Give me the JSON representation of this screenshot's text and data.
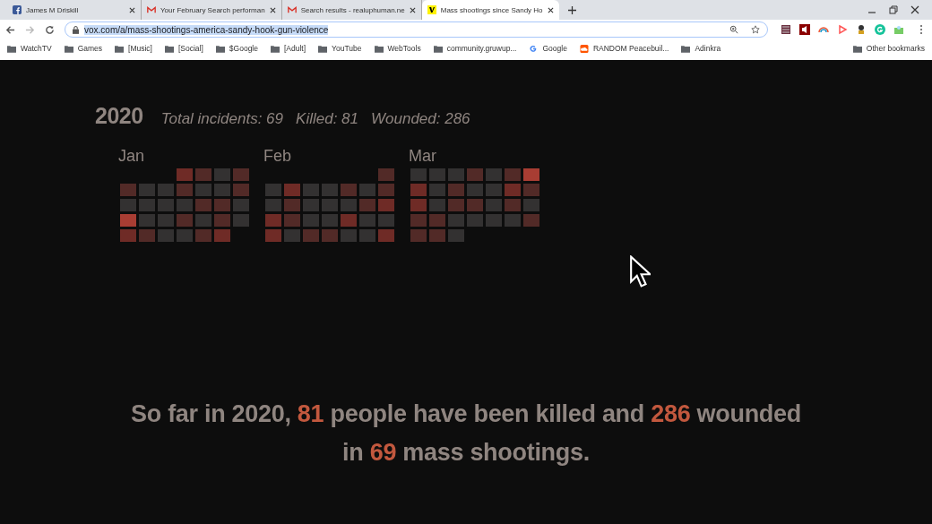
{
  "tabs": [
    {
      "title": "James M Driskill",
      "kind": "facebook",
      "selected": false
    },
    {
      "title": "Your February Search performan",
      "kind": "mail",
      "selected": false
    },
    {
      "title": "Search results - realuphuman.ne",
      "kind": "mail",
      "selected": false
    },
    {
      "title": "Mass shootings since Sandy Ho",
      "kind": "vox",
      "selected": true
    }
  ],
  "address": {
    "url": "vox.com/a/mass-shootings-america-sandy-hook-gun-violence"
  },
  "bookmarks": [
    {
      "label": "WatchTV",
      "kind": "folder"
    },
    {
      "label": "Games",
      "kind": "folder"
    },
    {
      "label": "[Music]",
      "kind": "folder"
    },
    {
      "label": "[Social]",
      "kind": "folder"
    },
    {
      "label": "$Google",
      "kind": "folder"
    },
    {
      "label": "[Adult]",
      "kind": "folder"
    },
    {
      "label": "YouTube",
      "kind": "folder"
    },
    {
      "label": "WebTools",
      "kind": "folder"
    },
    {
      "label": "community.gruwup...",
      "kind": "folder"
    },
    {
      "label": "Google",
      "kind": "google"
    },
    {
      "label": "RANDOM Peacebuil...",
      "kind": "cloud"
    },
    {
      "label": "Adinkra",
      "kind": "folder"
    }
  ],
  "other_bookmarks": "Other bookmarks",
  "summary": {
    "year": "2020",
    "stats": [
      "Total incidents: 69",
      "Killed: 81",
      "Wounded: 286"
    ]
  },
  "months": [
    {
      "label": "Jan",
      "days": [
        {
          "color": "#6f2b26"
        },
        {
          "color": "#522a27"
        },
        {
          "color": "#333131"
        },
        {
          "color": "#522a27"
        },
        {
          "color": "#522a27"
        },
        {
          "color": "#333131"
        },
        {
          "color": "#333131"
        },
        {
          "color": "#522a27"
        },
        {
          "color": "#333131"
        },
        {
          "color": "#333131"
        },
        {
          "color": "#522a27"
        },
        {
          "color": "#333131"
        },
        {
          "color": "#333131"
        },
        {
          "color": "#333131"
        },
        {
          "color": "#333131"
        },
        {
          "color": "#522a27"
        },
        {
          "color": "#522a27"
        },
        {
          "color": "#333131"
        },
        {
          "color": "#a83d33"
        },
        {
          "color": "#333131"
        },
        {
          "color": "#333131"
        },
        {
          "color": "#522a27"
        },
        {
          "color": "#333131"
        },
        {
          "color": "#522a27"
        },
        {
          "color": "#333131"
        },
        {
          "color": "#6f2b26"
        },
        {
          "color": "#522a27"
        },
        {
          "color": "#333131"
        },
        {
          "color": "#333131"
        },
        {
          "color": "#522a27"
        },
        {
          "color": "#6f2b26"
        }
      ]
    },
    {
      "label": "Feb",
      "days": [
        {
          "color": "#522a27"
        },
        {
          "color": "#333131"
        },
        {
          "color": "#6f2b26"
        },
        {
          "color": "#333131"
        },
        {
          "color": "#333131"
        },
        {
          "color": "#522a27"
        },
        {
          "color": "#333131"
        },
        {
          "color": "#522a27"
        },
        {
          "color": "#333131"
        },
        {
          "color": "#522a27"
        },
        {
          "color": "#333131"
        },
        {
          "color": "#333131"
        },
        {
          "color": "#333131"
        },
        {
          "color": "#522a27"
        },
        {
          "color": "#6f2b26"
        },
        {
          "color": "#6f2b26"
        },
        {
          "color": "#522a27"
        },
        {
          "color": "#333131"
        },
        {
          "color": "#333131"
        },
        {
          "color": "#6f2b26"
        },
        {
          "color": "#333131"
        },
        {
          "color": "#333131"
        },
        {
          "color": "#6f2b26"
        },
        {
          "color": "#333131"
        },
        {
          "color": "#522a27"
        },
        {
          "color": "#522a27"
        },
        {
          "color": "#333131"
        },
        {
          "color": "#333131"
        },
        {
          "color": "#6f2b26"
        }
      ]
    },
    {
      "label": "Mar",
      "days": [
        {
          "color": "#333131"
        },
        {
          "color": "#333131"
        },
        {
          "color": "#333131"
        },
        {
          "color": "#522a27"
        },
        {
          "color": "#333131"
        },
        {
          "color": "#522a27"
        },
        {
          "color": "#a83d33"
        },
        {
          "color": "#6f2b26"
        },
        {
          "color": "#333131"
        },
        {
          "color": "#522a27"
        },
        {
          "color": "#333131"
        },
        {
          "color": "#333131"
        },
        {
          "color": "#6f2b26"
        },
        {
          "color": "#522a27"
        },
        {
          "color": "#6f2b26"
        },
        {
          "color": "#333131"
        },
        {
          "color": "#522a27"
        },
        {
          "color": "#522a27"
        },
        {
          "color": "#333131"
        },
        {
          "color": "#522a27"
        },
        {
          "color": "#333131"
        },
        {
          "color": "#522a27"
        },
        {
          "color": "#522a27"
        },
        {
          "color": "#333131"
        },
        {
          "color": "#333131"
        },
        {
          "color": "#333131"
        },
        {
          "color": "#333131"
        },
        {
          "color": "#522a27"
        },
        {
          "color": "#522a27"
        },
        {
          "color": "#522a27"
        },
        {
          "color": "#333131"
        }
      ]
    }
  ],
  "headline": [
    "So far in 2020, **81** people have been killed and **286** wounded",
    "in **69** mass shootings."
  ]
}
